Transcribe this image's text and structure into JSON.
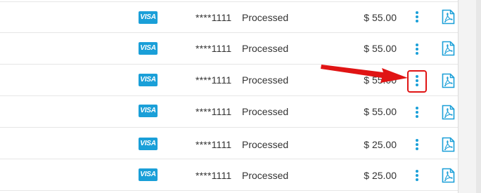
{
  "rows": [
    {
      "card_brand": "VISA",
      "card_number": "****1111",
      "status": "Processed",
      "amount": "$ 55.00"
    },
    {
      "card_brand": "VISA",
      "card_number": "****1111",
      "status": "Processed",
      "amount": "$ 55.00"
    },
    {
      "card_brand": "VISA",
      "card_number": "****1111",
      "status": "Processed",
      "amount": "$ 55.00"
    },
    {
      "card_brand": "VISA",
      "card_number": "****1111",
      "status": "Processed",
      "amount": "$ 55.00"
    },
    {
      "card_brand": "VISA",
      "card_number": "****1111",
      "status": "Processed",
      "amount": "$ 25.00"
    },
    {
      "card_brand": "VISA",
      "card_number": "****1111",
      "status": "Processed",
      "amount": "$ 25.00"
    }
  ],
  "icons": {
    "menu": "kebab-menu-icon",
    "document": "pdf-document-icon"
  },
  "colors": {
    "accent": "#1a9fd8",
    "annotation": "#e01414"
  }
}
